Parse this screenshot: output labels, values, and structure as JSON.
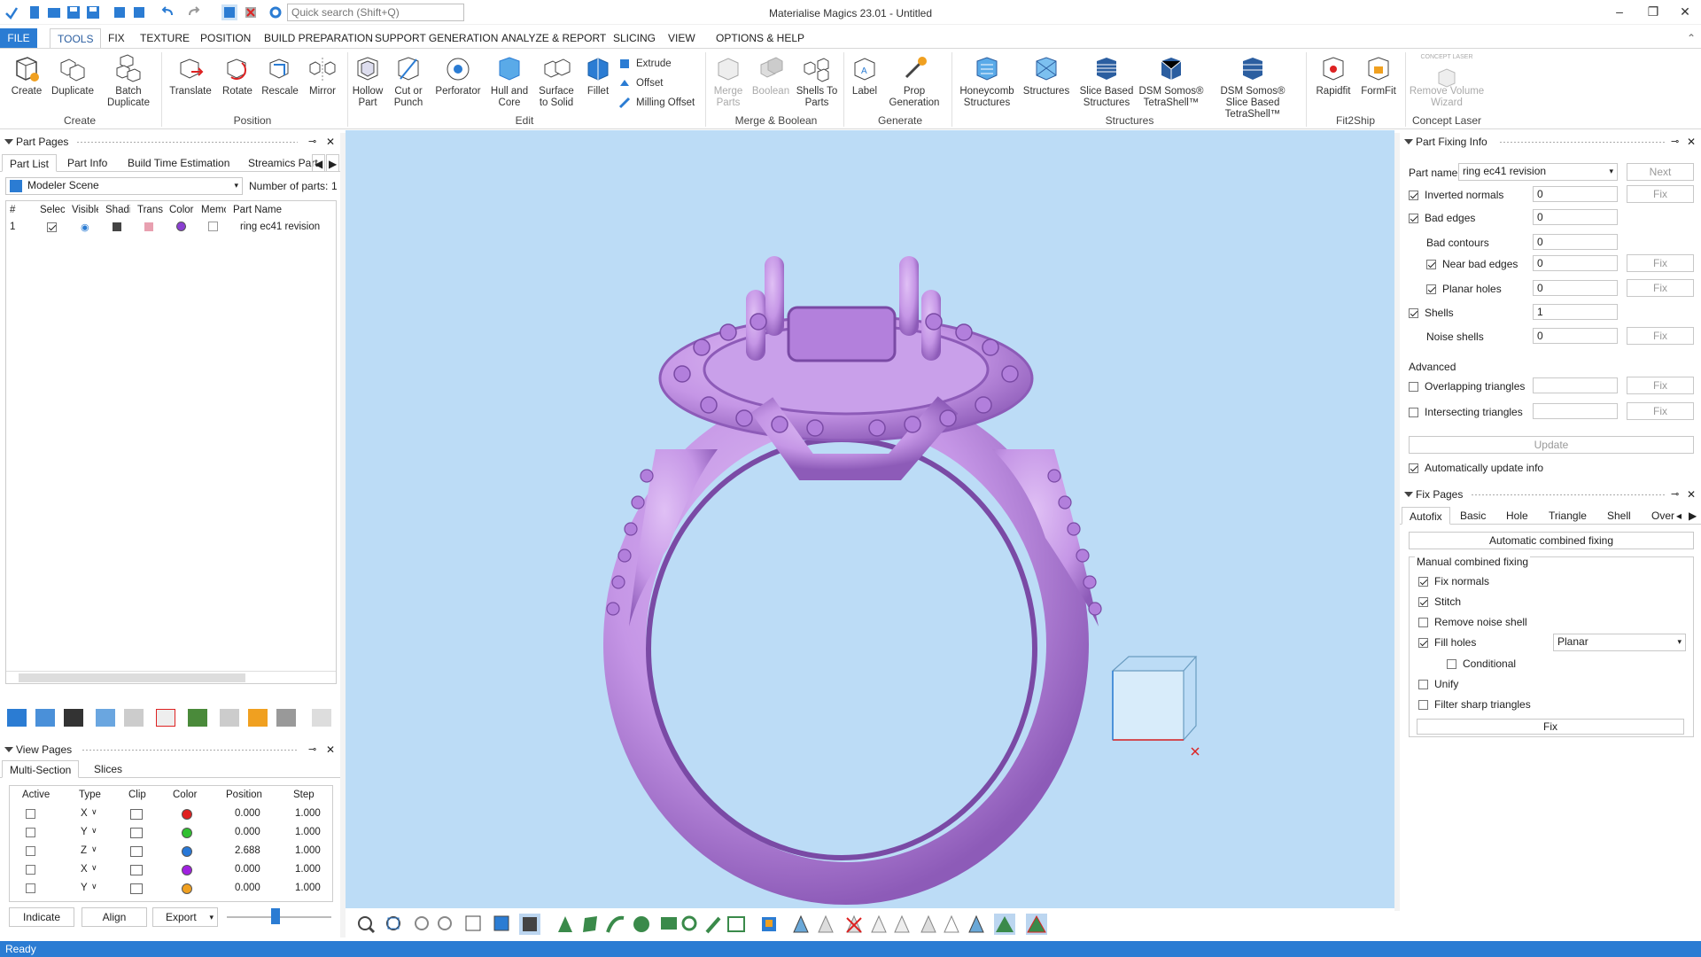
{
  "app": {
    "title": "Materialise Magics 23.01 - Untitled",
    "search_placeholder": "Quick search (Shift+Q)",
    "status": "Ready"
  },
  "menu": [
    "FILE",
    "TOOLS",
    "FIX",
    "TEXTURE",
    "POSITION",
    "BUILD PREPARATION",
    "SUPPORT GENERATION",
    "ANALYZE & REPORT",
    "SLICING",
    "VIEW",
    "OPTIONS & HELP"
  ],
  "ribbon": {
    "create": {
      "label": "Create",
      "buttons": [
        "Create",
        "Duplicate",
        "Batch Duplicate"
      ]
    },
    "position": {
      "label": "Position",
      "buttons": [
        "Translate",
        "Rotate",
        "Rescale",
        "Mirror"
      ]
    },
    "edit": {
      "label": "Edit",
      "buttons": [
        "Hollow Part",
        "Cut or Punch",
        "Perforator",
        "Hull and Core",
        "Surface to Solid",
        "Fillet"
      ],
      "small": [
        "Extrude",
        "Offset",
        "Milling Offset"
      ]
    },
    "merge": {
      "label": "Merge & Boolean",
      "buttons": [
        "Merge Parts",
        "Boolean",
        "Shells To Parts"
      ]
    },
    "generate": {
      "label": "Generate",
      "buttons": [
        "Label",
        "Prop Generation"
      ]
    },
    "structures": {
      "label": "Structures",
      "buttons": [
        "Honeycomb Structures",
        "Structures",
        "Slice Based Structures",
        "DSM Somos® TetraShell™",
        "DSM Somos® Slice Based TetraShell™"
      ]
    },
    "fit2ship": {
      "label": "Fit2Ship",
      "buttons": [
        "Rapidfit",
        "FormFit"
      ]
    },
    "laser": {
      "label": "Concept Laser",
      "buttons": [
        "Remove Volume Wizard"
      ],
      "badge": "CONCEPT LASER"
    }
  },
  "part_pages": {
    "title": "Part Pages",
    "tabs": [
      "Part List",
      "Part Info",
      "Build Time Estimation",
      "Streamics Part"
    ],
    "scene": "Modeler Scene",
    "count_label": "Number of parts:",
    "count": "1",
    "columns": [
      "#",
      "Select",
      "Visible",
      "Shading",
      "Trans",
      "Color",
      "Memo",
      "Part Name"
    ],
    "rows": [
      {
        "num": "1",
        "name": "ring ec41 revision",
        "color": "#8a3fd1"
      }
    ]
  },
  "view_pages": {
    "title": "View Pages",
    "tabs": [
      "Multi-Section",
      "Slices"
    ],
    "columns": [
      "Active",
      "Type",
      "Clip",
      "Color",
      "Position",
      "Step"
    ],
    "rows": [
      {
        "type": "X",
        "color": "#e02020",
        "position": "0.000",
        "step": "1.000"
      },
      {
        "type": "Y",
        "color": "#30c030",
        "position": "0.000",
        "step": "1.000"
      },
      {
        "type": "Z",
        "color": "#2878d8",
        "position": "2.688",
        "step": "1.000"
      },
      {
        "type": "X",
        "color": "#a020e0",
        "position": "0.000",
        "step": "1.000"
      },
      {
        "type": "Y",
        "color": "#f0a020",
        "position": "0.000",
        "step": "1.000"
      }
    ],
    "buttons": [
      "Indicate",
      "Align",
      "Export"
    ]
  },
  "part_fixing": {
    "title": "Part Fixing Info",
    "part_name_label": "Part name",
    "part_name": "ring ec41 revision",
    "next": "Next",
    "fix": "Fix",
    "rows": [
      {
        "label": "Inverted normals",
        "value": "0",
        "checked": true
      },
      {
        "label": "Bad edges",
        "value": "0",
        "checked": true
      },
      {
        "label": "Bad contours",
        "value": "0"
      },
      {
        "label": "Near bad edges",
        "value": "0",
        "checked": true
      },
      {
        "label": "Planar holes",
        "value": "0",
        "checked": true
      },
      {
        "label": "Shells",
        "value": "1",
        "checked": true
      },
      {
        "label": "Noise shells",
        "value": "0"
      }
    ],
    "advanced": "Advanced",
    "overlapping": "Overlapping triangles",
    "intersecting": "Intersecting triangles",
    "update": "Update",
    "auto_update": "Automatically update info"
  },
  "fix_pages": {
    "title": "Fix Pages",
    "tabs": [
      "Autofix",
      "Basic",
      "Hole",
      "Triangle",
      "Shell",
      "Over"
    ],
    "auto_combined": "Automatic combined fixing",
    "manual_label": "Manual combined fixing",
    "options": [
      "Fix normals",
      "Stitch",
      "Remove noise shell",
      "Fill holes",
      "Conditional",
      "Unify",
      "Filter sharp triangles"
    ],
    "fill_mode": "Planar",
    "fix": "Fix"
  },
  "colors": {
    "accent": "#2b7cd3",
    "viewport": "#bcdcf6",
    "part": "#c596e6"
  }
}
